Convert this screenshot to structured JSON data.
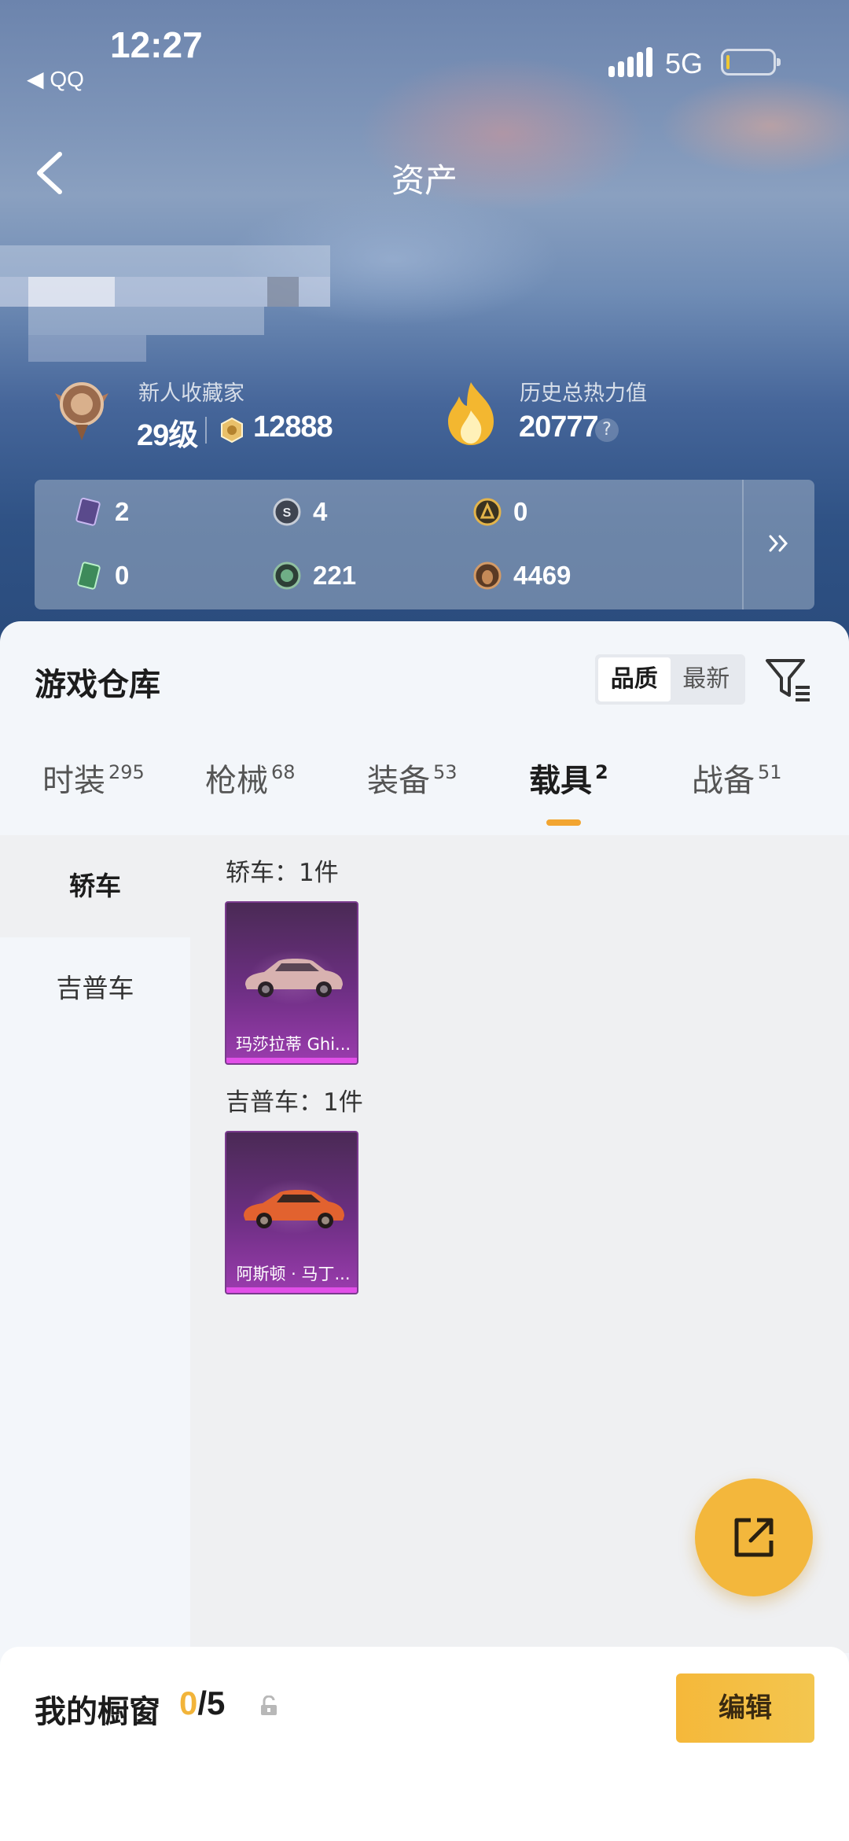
{
  "status_bar": {
    "time": "12:27",
    "back_app": "◀ QQ",
    "network": "5G"
  },
  "nav": {
    "title": "资产"
  },
  "profile": {
    "rank_title": "新人收藏家",
    "level": "29级",
    "coins": "12888",
    "heat_title": "历史总热力值",
    "heat_value": "20777",
    "help": "?"
  },
  "currencies": [
    {
      "icon": "purple-card-icon",
      "value": "2"
    },
    {
      "icon": "silver-token-icon",
      "value": "4"
    },
    {
      "icon": "gold-token-icon",
      "value": "0"
    },
    {
      "icon": "green-card-icon",
      "value": "0"
    },
    {
      "icon": "green-orb-icon",
      "value": "221"
    },
    {
      "icon": "bronze-bag-icon",
      "value": "4469"
    }
  ],
  "warehouse": {
    "title": "游戏仓库",
    "sort_options": [
      "品质",
      "最新"
    ],
    "sort_active": "品质",
    "tabs": [
      {
        "label": "时装",
        "count": "295"
      },
      {
        "label": "枪械",
        "count": "68"
      },
      {
        "label": "装备",
        "count": "53"
      },
      {
        "label": "载具",
        "count": "2"
      },
      {
        "label": "战备",
        "count": "51"
      }
    ],
    "active_tab": "载具",
    "categories": [
      "轿车",
      "吉普车"
    ],
    "active_category": "轿车",
    "groups": [
      {
        "label": "轿车：1件",
        "items": [
          {
            "name": "玛莎拉蒂 Ghi...",
            "color": "#c9a4a3"
          }
        ]
      },
      {
        "label": "吉普车：1件",
        "items": [
          {
            "name": "阿斯顿 · 马丁...",
            "color": "#e2622f"
          }
        ]
      }
    ]
  },
  "showcase": {
    "title": "我的橱窗",
    "current": "0",
    "total": "/5",
    "edit": "编辑"
  },
  "colors": {
    "accent": "#f2a531",
    "card_purple": "#6e2f84",
    "card_bar": "#e24fe8"
  }
}
